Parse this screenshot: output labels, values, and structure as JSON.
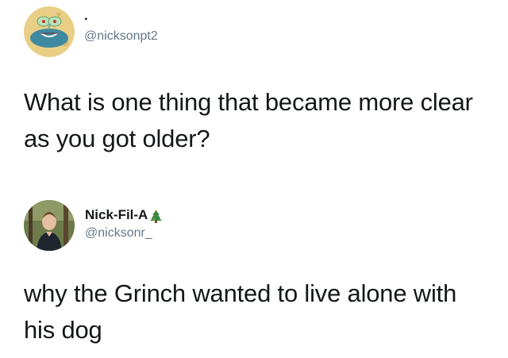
{
  "tweets": [
    {
      "display_name": ".",
      "handle": "@nicksonpt2",
      "text": "What is one thing that became more clear as you got older?",
      "avatar_icon": "cartoon-squidward-avatar-icon"
    },
    {
      "display_name": "Nick-Fil-A",
      "name_emoji_icon": "christmas-tree-icon",
      "handle": "@nicksonr_",
      "text": "why the Grinch wanted to live alone with his dog",
      "avatar_icon": "person-photo-avatar-icon"
    }
  ]
}
